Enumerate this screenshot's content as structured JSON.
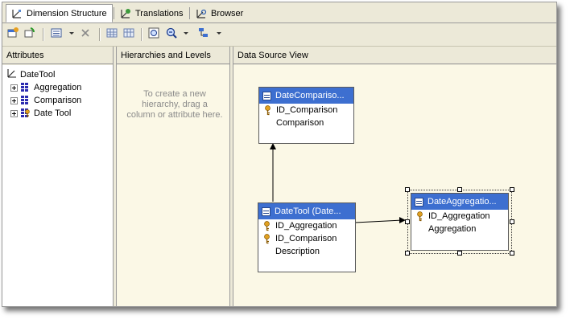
{
  "tabs": [
    {
      "label": "Dimension Structure",
      "icon": "dimension-structure-icon"
    },
    {
      "label": "Translations",
      "icon": "translations-icon"
    },
    {
      "label": "Browser",
      "icon": "browser-icon"
    }
  ],
  "toolbar": {
    "buttons": [
      "add-related-tables-icon",
      "refresh-icon",
      "show-list-icon",
      "delete-icon",
      "show-grid-icon",
      "zoom-icon",
      "zoom-out-icon",
      "arrange-tables-icon"
    ]
  },
  "attributes": {
    "header": "Attributes",
    "dimension_name": "DateTool",
    "items": [
      "Aggregation",
      "Comparison",
      "Date Tool"
    ]
  },
  "hierarchies": {
    "header": "Hierarchies and Levels",
    "hint": "To create a new hierarchy, drag a column or attribute here."
  },
  "dsv": {
    "header": "Data Source View",
    "tables": [
      {
        "title": "DateCompariso...",
        "columns": [
          {
            "name": "ID_Comparison",
            "key": true
          },
          {
            "name": "Comparison",
            "key": false
          }
        ]
      },
      {
        "title": "DateTool (Date...",
        "columns": [
          {
            "name": "ID_Aggregation",
            "key": true
          },
          {
            "name": "ID_Comparison",
            "key": true
          },
          {
            "name": "Description",
            "key": false
          }
        ]
      },
      {
        "title": "DateAggregatio...",
        "columns": [
          {
            "name": "ID_Aggregation",
            "key": true
          },
          {
            "name": "Aggregation",
            "key": false
          }
        ]
      }
    ]
  },
  "colors": {
    "window_bg": "#ece9d8",
    "dsv_bg": "#fbf8e6",
    "table_title": "#3d6fd0",
    "key_icon": "#e0a020"
  }
}
